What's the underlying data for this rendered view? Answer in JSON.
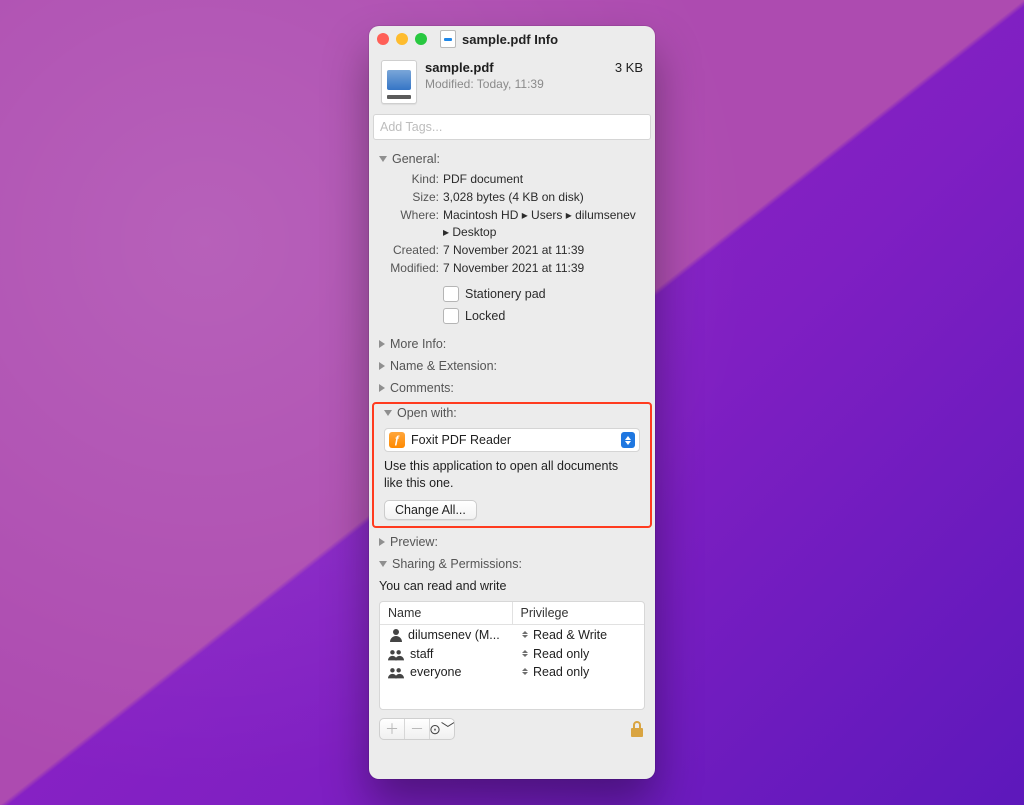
{
  "window_title": "sample.pdf Info",
  "header": {
    "filename": "sample.pdf",
    "modified_line": "Modified: Today, 11:39",
    "size_short": "3 KB"
  },
  "tags_placeholder": "Add Tags...",
  "sections": {
    "general": {
      "title": "General:",
      "kind_label": "Kind:",
      "kind_value": "PDF document",
      "size_label": "Size:",
      "size_value": "3,028 bytes (4 KB on disk)",
      "where_label": "Where:",
      "where_value": "Macintosh HD ▸ Users ▸ dilumsenev ▸ Desktop",
      "created_label": "Created:",
      "created_value": "7 November 2021 at 11:39",
      "modified_label": "Modified:",
      "modified_value": "7 November 2021 at 11:39",
      "stationery_label": "Stationery pad",
      "locked_label": "Locked"
    },
    "more_info": "More Info:",
    "name_ext": "Name & Extension:",
    "comments": "Comments:",
    "open_with": {
      "title": "Open with:",
      "app": "Foxit PDF Reader",
      "hint": "Use this application to open all documents like this one.",
      "change_all": "Change All..."
    },
    "preview": "Preview:",
    "sharing": {
      "title": "Sharing & Permissions:",
      "note": "You can read and write",
      "col_name": "Name",
      "col_priv": "Privilege",
      "rows": [
        {
          "name": "dilumsenev (M...",
          "priv": "Read & Write",
          "icon": "user"
        },
        {
          "name": "staff",
          "priv": "Read only",
          "icon": "group"
        },
        {
          "name": "everyone",
          "priv": "Read only",
          "icon": "group"
        }
      ]
    }
  }
}
